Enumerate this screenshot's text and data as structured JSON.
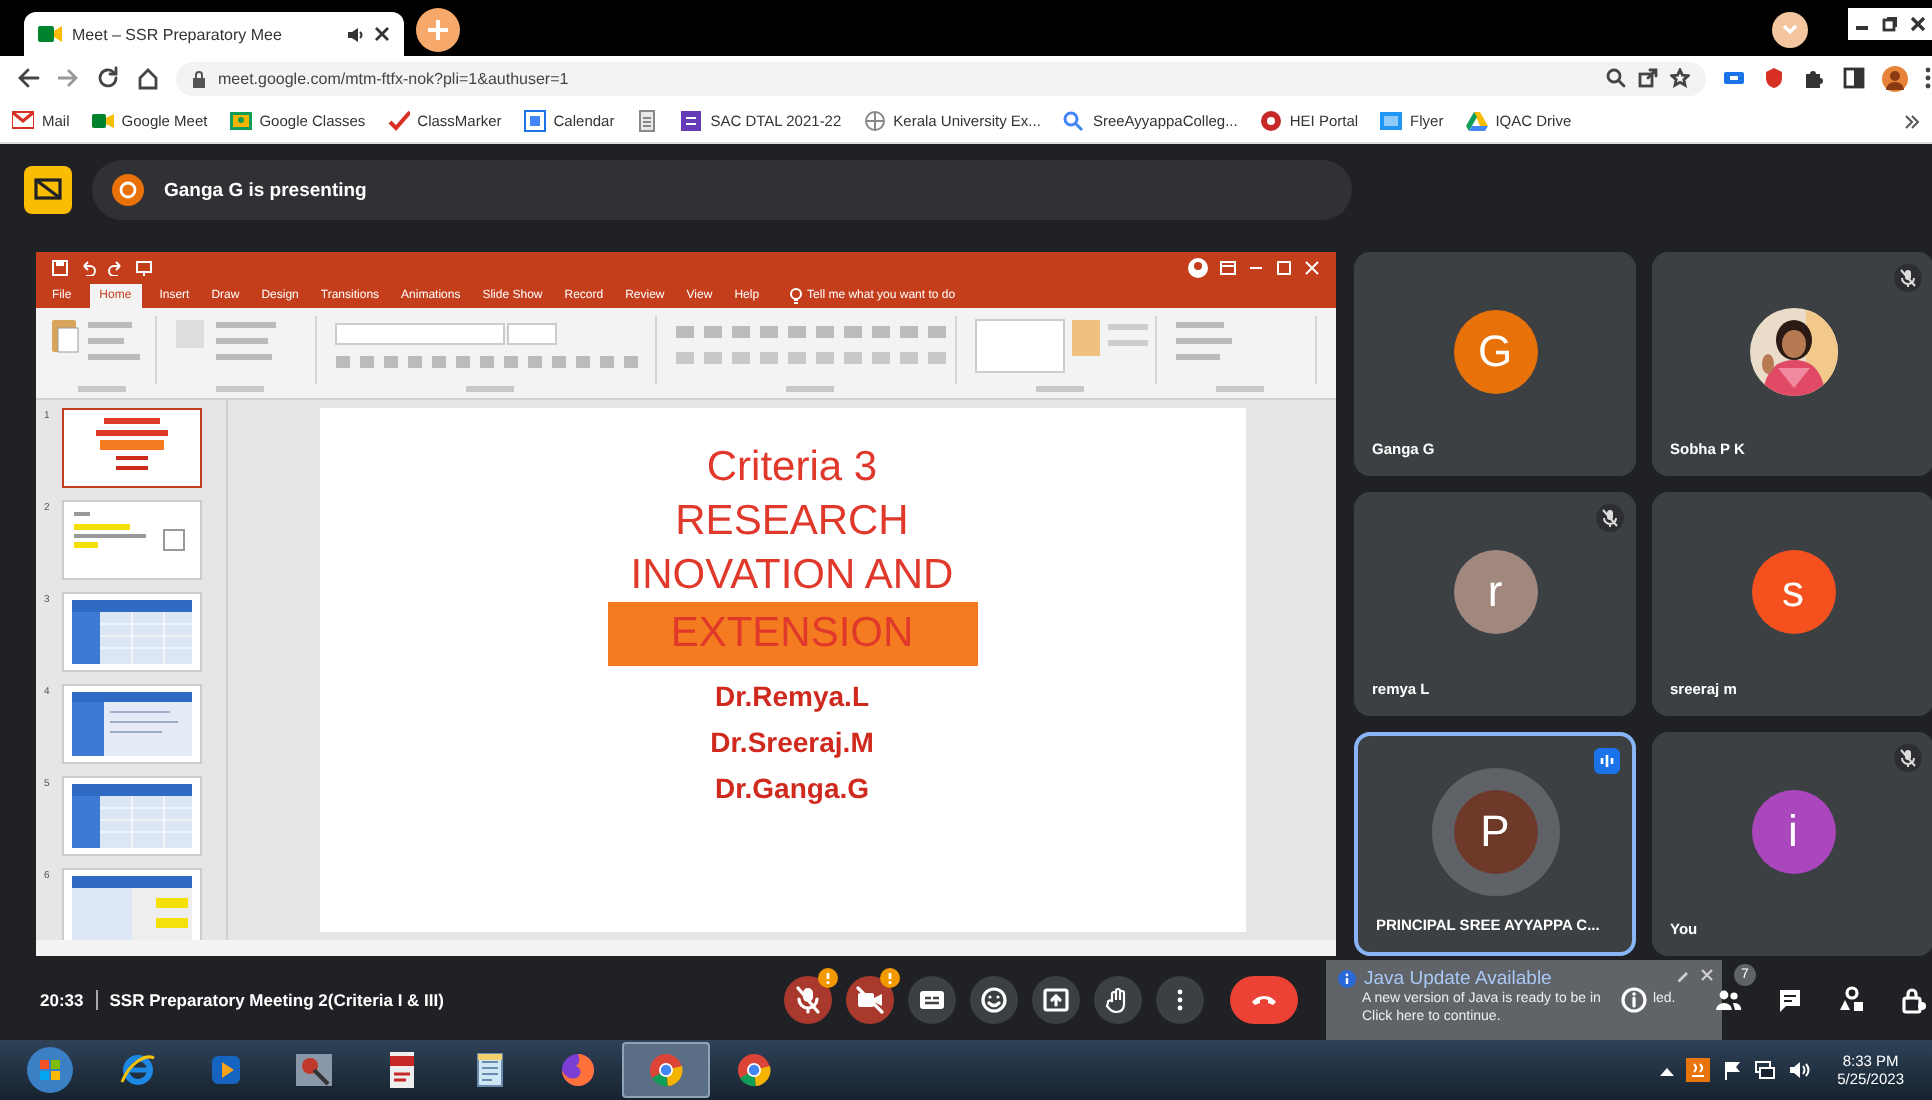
{
  "browser": {
    "tabs": [
      {
        "title": "Meet – SSR Preparatory Mee",
        "selected": true
      }
    ],
    "address": "meet.google.com/mtm-ftfx-nok?pli=1&authuser=1",
    "bookmarks": [
      {
        "label": "Mail",
        "kind": "gmail"
      },
      {
        "label": "Google Meet",
        "kind": "meet"
      },
      {
        "label": "Google Classes",
        "kind": "classroom"
      },
      {
        "label": "ClassMarker",
        "kind": "check"
      },
      {
        "label": "Calendar",
        "kind": "calendar"
      },
      {
        "kind": "doc"
      },
      {
        "label": "SAC DTAL 2021-22",
        "kind": "form"
      },
      {
        "label": "Kerala University Ex...",
        "kind": "globe"
      },
      {
        "label": "SreeAyyappaColleg...",
        "kind": "search"
      },
      {
        "label": "HEI Portal",
        "kind": "portal"
      },
      {
        "label": "Flyer",
        "kind": "slides"
      },
      {
        "label": "IQAC Drive",
        "kind": "drive"
      }
    ]
  },
  "meet": {
    "presenting": "Ganga G is presenting",
    "presentation": {
      "ribbon_tabs": [
        {
          "label": "File",
          "selected": false
        },
        {
          "label": "Home",
          "selected": true
        },
        {
          "label": "Insert",
          "selected": false
        },
        {
          "label": "Draw",
          "selected": false
        },
        {
          "label": "Design",
          "selected": false
        },
        {
          "label": "Transitions",
          "selected": false
        },
        {
          "label": "Animations",
          "selected": false
        },
        {
          "label": "Slide Show",
          "selected": false
        },
        {
          "label": "Record",
          "selected": false
        },
        {
          "label": "Review",
          "selected": false
        },
        {
          "label": "View",
          "selected": false
        },
        {
          "label": "Help",
          "selected": false
        }
      ],
      "search_hint": "Tell me what you want to do",
      "thumbnails": [
        {
          "number": "1",
          "kind": "title",
          "selected": true
        },
        {
          "number": "2",
          "kind": "text",
          "selected": false
        },
        {
          "number": "3",
          "kind": "table",
          "selected": false
        },
        {
          "number": "4",
          "kind": "list",
          "selected": false
        },
        {
          "number": "5",
          "kind": "table",
          "selected": false
        },
        {
          "number": "6",
          "kind": "highlight",
          "selected": false
        }
      ],
      "slide": [
        {
          "text": "Criteria 3",
          "kind": "heading"
        },
        {
          "text": "RESEARCH",
          "kind": "heading"
        },
        {
          "text": "INOVATION AND",
          "kind": "heading"
        },
        {
          "text": "EXTENSION",
          "kind": "banner"
        },
        {
          "text": "Dr.Remya.L",
          "kind": "author"
        },
        {
          "text": "Dr.Sreeraj.M",
          "kind": "author"
        },
        {
          "text": "Dr.Ganga.G",
          "kind": "author"
        }
      ]
    },
    "tiles": [
      {
        "name": "Ganga G",
        "kind": "avatar",
        "initial": "G",
        "color": "#e8710a",
        "muted": false,
        "speaking": false,
        "selected": false
      },
      {
        "name": "Sobha P K",
        "muted": true,
        "speaking": false,
        "selected": false
      },
      {
        "name": "remya L",
        "kind": "avatar",
        "initial": "r",
        "color": "#a1887f",
        "muted": true,
        "speaking": false,
        "selected": false
      },
      {
        "name": "sreeraj m",
        "kind": "avatar",
        "initial": "s",
        "color": "#f4511e",
        "muted": false,
        "speaking": false,
        "selected": false
      },
      {
        "name": "PRINCIPAL SREE AYYAPPA C...",
        "kind": "avatar",
        "initial": "P",
        "color": "#6d3a2a",
        "muted": false,
        "speaking": true,
        "selected": true
      },
      {
        "name": "You",
        "kind": "avatar",
        "initial": "i",
        "color": "#ab47bc",
        "muted": true,
        "speaking": false,
        "selected": false
      }
    ],
    "meeting_time": "20:33",
    "meeting_title": "SSR Preparatory Meeting 2(Criteria I & III)",
    "controls": [
      {
        "kind": "mic",
        "on": false,
        "alert": true
      },
      {
        "kind": "camera",
        "on": false,
        "alert": true
      },
      {
        "kind": "captions"
      },
      {
        "kind": "reactions"
      },
      {
        "kind": "present"
      },
      {
        "kind": "hand"
      },
      {
        "kind": "more"
      },
      {
        "kind": "leave"
      }
    ],
    "people_count": "7"
  },
  "notification": {
    "title": "Java Update Available",
    "text": "A new version of Java is ready to be in",
    "text_end": "led.",
    "link": "Click here to continue."
  },
  "taskbar": {
    "apps": [
      {
        "kind": "ie",
        "active": false
      },
      {
        "kind": "media",
        "active": false
      },
      {
        "kind": "tool",
        "active": false
      },
      {
        "kind": "pdf",
        "active": false
      },
      {
        "kind": "notes",
        "active": false
      },
      {
        "kind": "firefox",
        "active": false
      },
      {
        "kind": "chrome",
        "active": true
      },
      {
        "kind": "chrome",
        "active": false
      }
    ],
    "time": "8:33 PM",
    "date": "5/25/2023"
  }
}
